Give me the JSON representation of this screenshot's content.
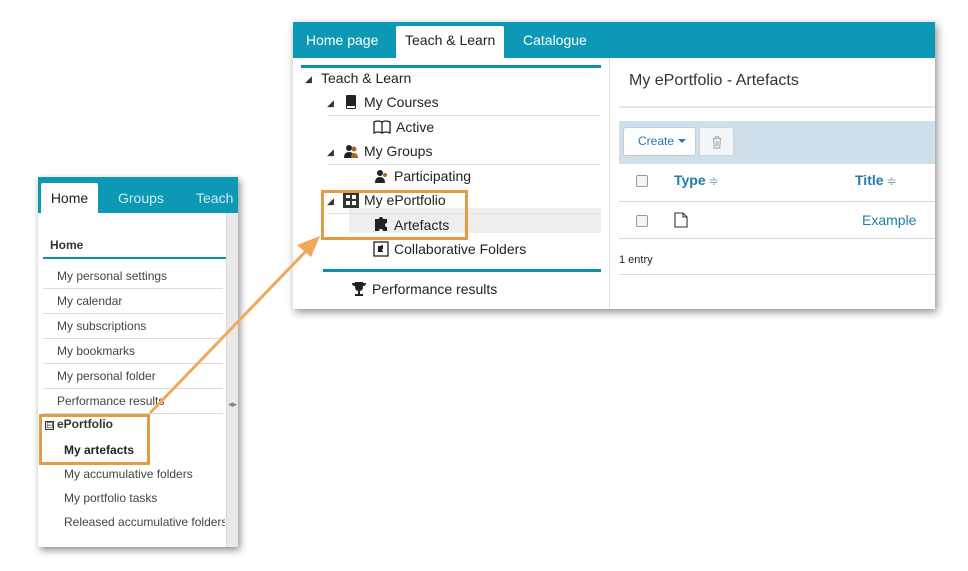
{
  "colors": {
    "accent": "#0d99b6",
    "highlight": "#f0a85a",
    "link": "#1d7fa8"
  },
  "old_ui": {
    "tabs": [
      "Home",
      "Groups",
      "Teach"
    ],
    "section_title": "Home",
    "items": [
      "My personal settings",
      "My calendar",
      "My subscriptions",
      "My bookmarks",
      "My personal folder",
      "Performance results"
    ],
    "eportfolio_title": "ePortfolio",
    "eportfolio_toggle": "⊟",
    "eportfolio_items": [
      "My artefacts",
      "My accumulative folders",
      "My portfolio tasks",
      "Released accumulative folders"
    ]
  },
  "new_ui": {
    "tabs": [
      "Home page",
      "Teach & Learn",
      "Catalogue"
    ],
    "tree": {
      "root": "Teach & Learn",
      "my_courses": "My Courses",
      "active": "Active",
      "my_groups": "My Groups",
      "participating": "Participating",
      "my_eportfolio": "My ePortfolio",
      "artefacts": "Artefacts",
      "collab_folders": "Collaborative Folders",
      "performance": "Performance results"
    },
    "content": {
      "title": "My ePortfolio - Artefacts",
      "create_label": "Create",
      "columns": [
        "Type",
        "Title"
      ],
      "sort_icon": "≑",
      "rows": [
        {
          "type_icon": "file-icon",
          "title": "Example"
        }
      ],
      "entry_count": "1 entry"
    }
  }
}
